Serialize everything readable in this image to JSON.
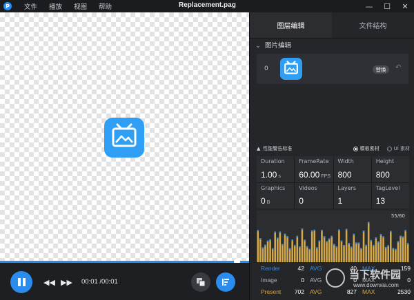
{
  "window": {
    "title": "Replacement.pag",
    "menu": [
      "文件",
      "播放",
      "视图",
      "帮助"
    ],
    "controls": {
      "minimize": "—",
      "maximize": "☐",
      "close": "✕"
    }
  },
  "player": {
    "time": "00:01 /00:01",
    "progress_fraction": 1.0
  },
  "panel": {
    "tabs": [
      {
        "label": "图层编辑",
        "active": true
      },
      {
        "label": "文件结构",
        "active": false
      }
    ],
    "section_title": "图片编辑",
    "layer": {
      "index": "0",
      "replace_label": "替换"
    },
    "perf": {
      "title": "性能警告标准",
      "option1": "模板素材",
      "option2": "UI 素材",
      "selected": "模板素材"
    },
    "stats": [
      {
        "label": "Duration",
        "value": "1.00",
        "unit": "s"
      },
      {
        "label": "FrameRate",
        "value": "60.00",
        "unit": "FPS"
      },
      {
        "label": "Width",
        "value": "800",
        "unit": ""
      },
      {
        "label": "Height",
        "value": "800",
        "unit": ""
      },
      {
        "label": "Graphics",
        "value": "0",
        "unit": "B"
      },
      {
        "label": "Videos",
        "value": "0",
        "unit": ""
      },
      {
        "label": "Layers",
        "value": "1",
        "unit": ""
      },
      {
        "label": "TagLevel",
        "value": "13",
        "unit": ""
      }
    ],
    "graph_scale": "55/60",
    "perf_table": [
      [
        "Render",
        "42",
        "AVG",
        "40",
        "MAX",
        "159"
      ],
      [
        "Image",
        "0",
        "AVG",
        "0",
        "MAX",
        "0"
      ],
      [
        "Present",
        "702",
        "AVG",
        "827",
        "MAX",
        "2530"
      ]
    ]
  },
  "watermark": {
    "line1": "当下软件园",
    "line2": "www.downxia.com"
  },
  "colors": {
    "accent": "#2b8cf0",
    "panel_bg": "#25262a",
    "bar_gold": "#d3a94a",
    "bar_blue": "#3a8de0",
    "present_label": "#d3a94a"
  }
}
